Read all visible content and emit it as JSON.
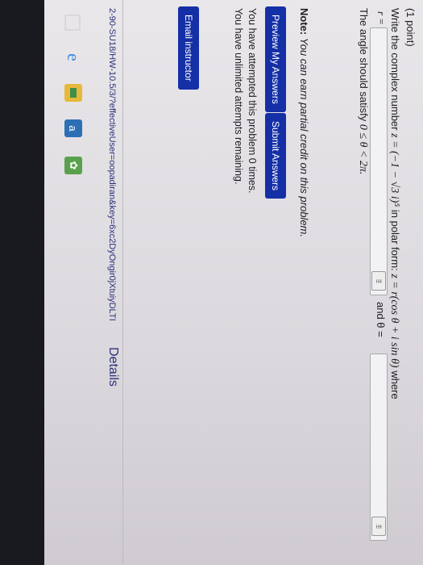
{
  "problem": {
    "points": "(1 point)",
    "question_prefix": "Write the complex number",
    "expression": "z = (−1 − √3 i)⁵",
    "question_middle": "in polar form:",
    "polar_form": "z = r(cos θ + i sin θ)",
    "question_suffix": "where",
    "r_label": "r =",
    "r_value": "",
    "theta_label": "and θ =",
    "theta_value": "",
    "matrix_icon_glyph": "⁞⁞⁞",
    "angle_condition_prefix": "The angle should satisfy",
    "angle_condition_math": "0 ≤ θ < 2π."
  },
  "note": {
    "bold": "Note:",
    "italic": "You can earn partial credit on this problem."
  },
  "buttons": {
    "preview": "Preview My Answers",
    "submit": "Submit Answers",
    "email": "Email instructor"
  },
  "status": {
    "attempted": "You have attempted this problem 0 times.",
    "remaining": "You have unlimited attempts remaining."
  },
  "footer": {
    "url": "2-90-SU18/HW-10.5/3/?effectiveUser=oopadiran&key=6xc2DyOngir0jXtuiyDLTI",
    "details": "Details"
  },
  "taskbar": {
    "icons": [
      "window-icon",
      "edge-icon",
      "files-icon",
      "amazon-icon",
      "photos-icon",
      "arrow-icon"
    ]
  },
  "colors": {
    "button": "#1530a6",
    "link": "#2a2f7a"
  }
}
